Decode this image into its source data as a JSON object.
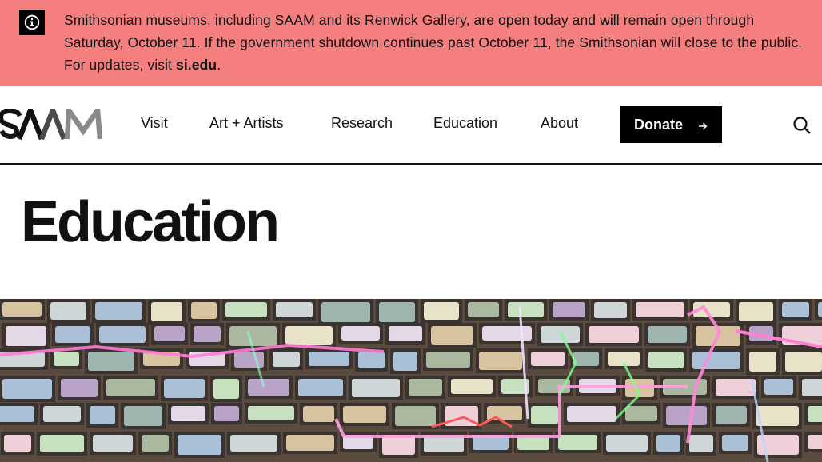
{
  "alert": {
    "icon": "info-icon",
    "text_before": "Smithsonian museums, including SAAM and its Renwick Gallery, are open today and will remain open through Saturday, October 11. If the government shutdown continues past October 11, the Smithsonian will close to the public. For updates, visit ",
    "link": "si.edu",
    "text_after": ".",
    "background": "#f57e7e"
  },
  "header": {
    "logo_text": "SAAM",
    "nav": [
      "Visit",
      "Art + Artists",
      "Research",
      "Education",
      "About"
    ],
    "donate_label": "Donate",
    "donate_icon": "arrow-right-icon",
    "search_icon": "search-icon"
  },
  "page": {
    "title": "Education"
  },
  "hero": {
    "image": "hero-image"
  }
}
